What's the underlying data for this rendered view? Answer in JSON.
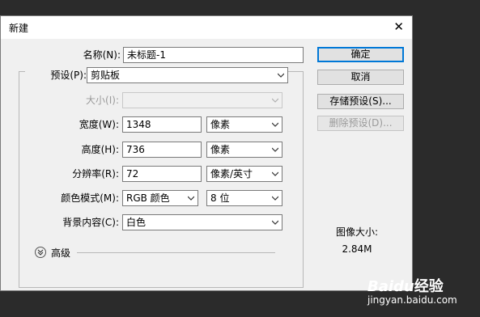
{
  "dialog": {
    "title": "新建",
    "close_glyph": "✕"
  },
  "form": {
    "name_label": "名称(N):",
    "name_value": "未标题-1",
    "preset_label": "预设(P):",
    "preset_value": "剪贴板",
    "size_label": "大小(I):",
    "size_value": "",
    "width_label": "宽度(W):",
    "width_value": "1348",
    "width_unit": "像素",
    "height_label": "高度(H):",
    "height_value": "736",
    "height_unit": "像素",
    "resolution_label": "分辨率(R):",
    "resolution_value": "72",
    "resolution_unit": "像素/英寸",
    "color_mode_label": "颜色模式(M):",
    "color_mode_value": "RGB 颜色",
    "bit_depth_value": "8 位",
    "background_label": "背景内容(C):",
    "background_value": "白色",
    "advanced_label": "高级"
  },
  "buttons": {
    "ok": "确定",
    "cancel": "取消",
    "save_preset": "存储预设(S)...",
    "delete_preset": "删除预设(D)..."
  },
  "image_size": {
    "label": "图像大小:",
    "value": "2.84M"
  },
  "watermark": {
    "brand": "Baidu",
    "brand_cn": "经验",
    "url": "jingyan.baidu.com"
  },
  "icons": {
    "close": "close-icon",
    "dropdown": "chevron-down-icon",
    "advanced": "expand-advanced-icon"
  },
  "colors": {
    "primary_border": "#0078d7",
    "background": "#2b2b2b",
    "dialog": "#f0f0f0"
  }
}
